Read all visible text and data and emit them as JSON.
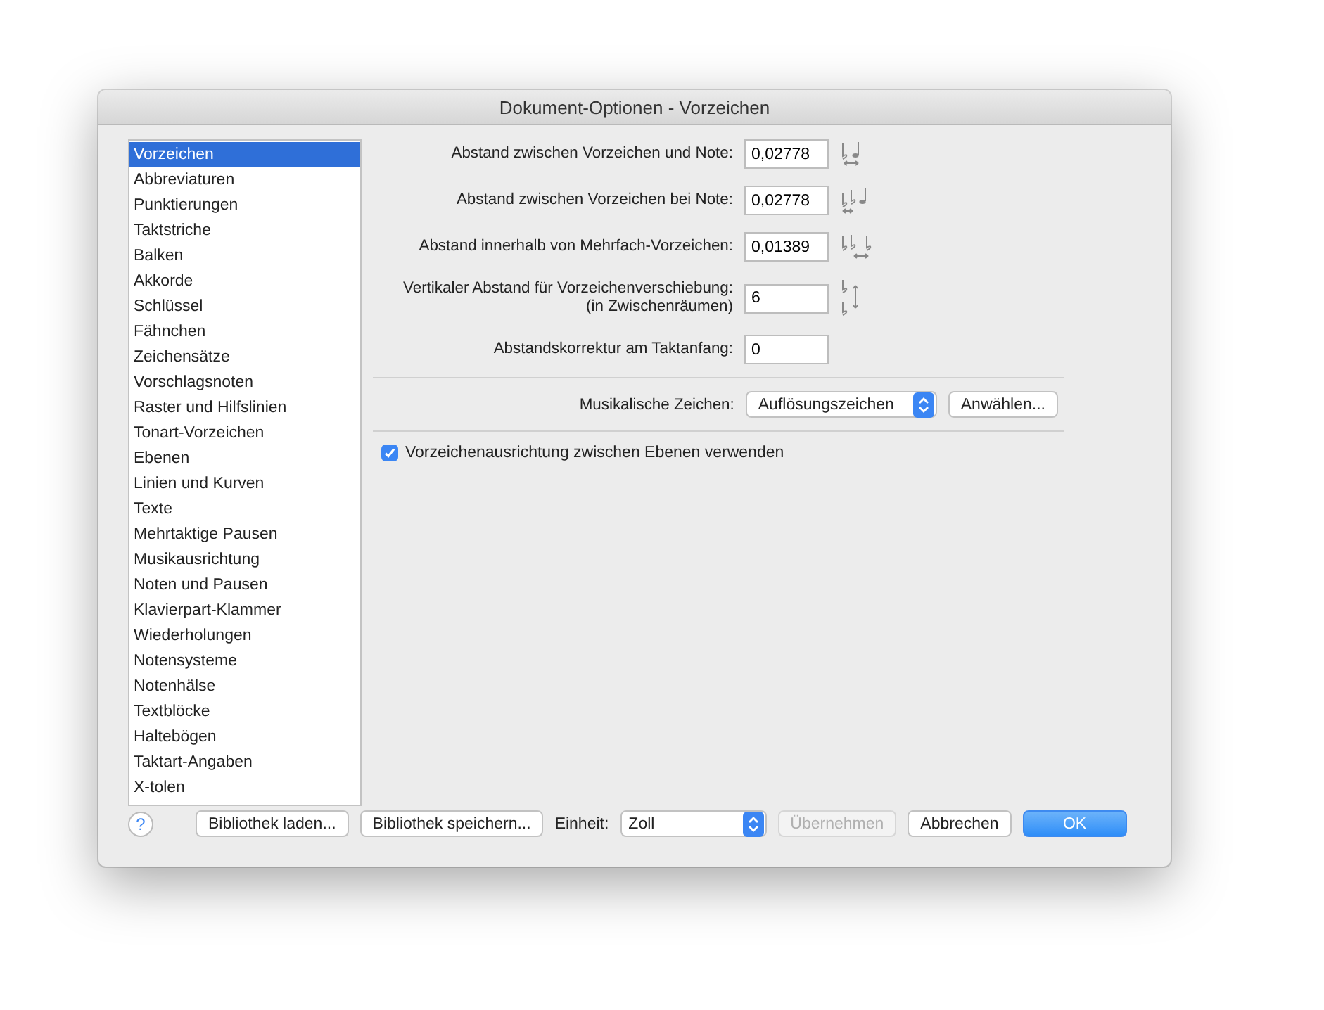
{
  "window": {
    "title": "Dokument-Optionen - Vorzeichen"
  },
  "sidebar": {
    "items": [
      {
        "label": "Vorzeichen",
        "selected": true
      },
      {
        "label": "Abbreviaturen",
        "selected": false
      },
      {
        "label": "Punktierungen",
        "selected": false
      },
      {
        "label": "Taktstriche",
        "selected": false
      },
      {
        "label": "Balken",
        "selected": false
      },
      {
        "label": "Akkorde",
        "selected": false
      },
      {
        "label": "Schlüssel",
        "selected": false
      },
      {
        "label": "Fähnchen",
        "selected": false
      },
      {
        "label": "Zeichensätze",
        "selected": false
      },
      {
        "label": "Vorschlagsnoten",
        "selected": false
      },
      {
        "label": "Raster und Hilfslinien",
        "selected": false
      },
      {
        "label": "Tonart-Vorzeichen",
        "selected": false
      },
      {
        "label": "Ebenen",
        "selected": false
      },
      {
        "label": "Linien und Kurven",
        "selected": false
      },
      {
        "label": "Texte",
        "selected": false
      },
      {
        "label": "Mehrtaktige Pausen",
        "selected": false
      },
      {
        "label": "Musikausrichtung",
        "selected": false
      },
      {
        "label": "Noten und Pausen",
        "selected": false
      },
      {
        "label": "Klavierpart-Klammer",
        "selected": false
      },
      {
        "label": "Wiederholungen",
        "selected": false
      },
      {
        "label": "Notensysteme",
        "selected": false
      },
      {
        "label": "Notenhälse",
        "selected": false
      },
      {
        "label": "Textblöcke",
        "selected": false
      },
      {
        "label": "Haltebögen",
        "selected": false
      },
      {
        "label": "Taktart-Angaben",
        "selected": false
      },
      {
        "label": "X-tolen",
        "selected": false
      }
    ]
  },
  "fields": [
    {
      "label": "Abstand zwischen Vorzeichen und Note:",
      "value": "0,02778",
      "kind": "note-gap"
    },
    {
      "label": "Abstand zwischen Vorzeichen bei Note:",
      "value": "0,02778",
      "kind": "pair-gap"
    },
    {
      "label": "Abstand innerhalb von Mehrfach-Vorzeichen:",
      "value": "0,01389",
      "kind": "multi-gap"
    },
    {
      "label": "Vertikaler Abstand für Vorzeichenverschiebung:",
      "sublabel": "(in Zwischenräumen)",
      "value": "6",
      "kind": "vertical"
    },
    {
      "label": "Abstandskorrektur am Taktanfang:",
      "value": "0"
    }
  ],
  "musical_symbols": {
    "label": "Musikalische Zeichen:",
    "value": "Auflösungszeichen",
    "button": "Anwählen..."
  },
  "checkbox": {
    "label": "Vorzeichenausrichtung zwischen Ebenen verwenden",
    "checked": true
  },
  "footer": {
    "help": "?",
    "load": "Bibliothek laden...",
    "save": "Bibliothek speichern...",
    "unit_label": "Einheit:",
    "unit": "Zoll",
    "apply": {
      "label": "Übernehmen",
      "disabled": true
    },
    "cancel": "Abbrechen",
    "ok": "OK"
  }
}
